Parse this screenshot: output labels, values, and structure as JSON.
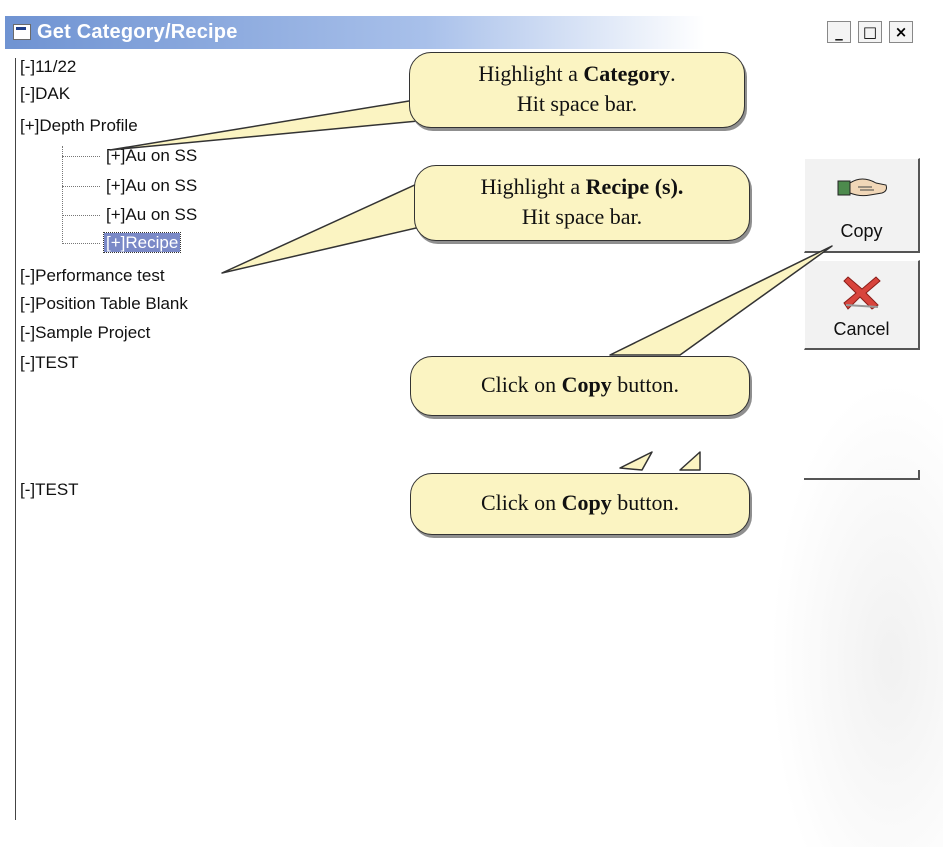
{
  "window": {
    "title": "Get Category/Recipe",
    "controls": {
      "minimize": "_",
      "maximize": "□",
      "close": "×"
    }
  },
  "tree": {
    "items": [
      {
        "label": "[-]11/22"
      },
      {
        "label": "[-]DAK"
      },
      {
        "label": "[+]Depth Profile"
      },
      {
        "label": "[+]Au on SS"
      },
      {
        "label": "[+]Au on SS"
      },
      {
        "label": "[+]Au on SS"
      },
      {
        "label": "[+]Recipe",
        "selected": true
      },
      {
        "label": "[-]Performance test"
      },
      {
        "label": "[-]Position Table Blank"
      },
      {
        "label": "[-]Sample Project"
      },
      {
        "label": "[-]TEST"
      },
      {
        "label": "[-]TEST"
      }
    ]
  },
  "buttons": {
    "copy": {
      "label": "Copy",
      "icon": "handshake-icon"
    },
    "cancel": {
      "label": "Cancel",
      "icon": "red-x-icon"
    }
  },
  "callouts": [
    {
      "pre": "Highlight a ",
      "bold": "Category",
      "post": ".",
      "line2": "Hit space bar."
    },
    {
      "pre": "Highlight a ",
      "bold": "Recipe (s).",
      "post": "",
      "line2": "Hit space bar."
    },
    {
      "pre": "Click on ",
      "bold": "Copy",
      "post": " button."
    },
    {
      "pre": "Click on ",
      "bold": "Copy",
      "post": " button."
    }
  ],
  "colors": {
    "callout_fill": "#fbf4c2",
    "selection": "#7a89c7",
    "titlebar": "#6f93d2"
  }
}
